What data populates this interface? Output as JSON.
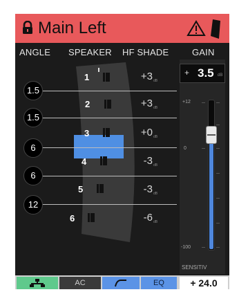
{
  "header": {
    "title": "Main Left",
    "lock_icon": "lock-icon",
    "warning_icon": "warning-triangle-icon",
    "speaker_icon": "speaker-icon",
    "bg_color": "#e8595b"
  },
  "columns": {
    "angle": "ANGLE",
    "speaker": "SPEAKER",
    "hf_shade": "HF SHADE",
    "gain": "GAIN"
  },
  "angles": [
    "1.5",
    "1.5",
    "6",
    "6",
    "12"
  ],
  "speakers": [
    {
      "num": "1",
      "hf": "+3",
      "unit": "dB"
    },
    {
      "num": "2",
      "hf": "+3",
      "unit": "dB"
    },
    {
      "num": "3",
      "hf": "+0",
      "unit": "dB",
      "selected": true
    },
    {
      "num": "4",
      "hf": "-3",
      "unit": "dB"
    },
    {
      "num": "5",
      "hf": "-3",
      "unit": "dB"
    },
    {
      "num": "6",
      "hf": "-6",
      "unit": "dB"
    }
  ],
  "gain": {
    "sign": "+",
    "value": "3.5",
    "unit": "dB",
    "scale_top": "+12",
    "scale_mid": "0",
    "scale_bottom": "-100",
    "fader_level": 0.78,
    "sensitivity_label": "SENSITIV"
  },
  "bottom": {
    "network_icon": "network-icon",
    "ac_label": "AC",
    "curve_icon": "array-curve-icon",
    "eq_label": "EQ",
    "sensitivity_value": "+ 24.0"
  },
  "accent_color": "#4f8fe3"
}
